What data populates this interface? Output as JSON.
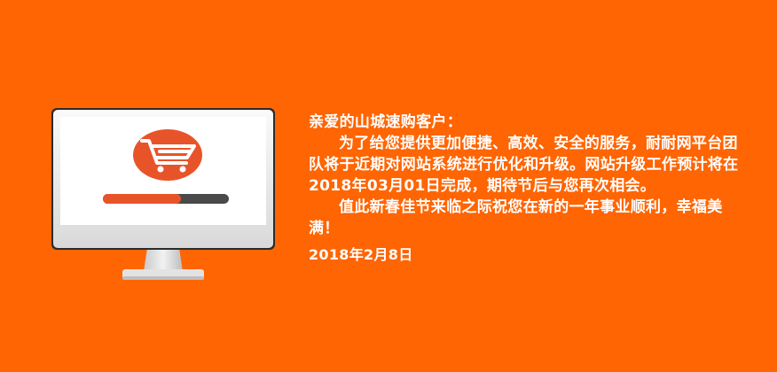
{
  "notice": {
    "greeting": "亲爱的山城速购客户：",
    "paragraph1": "为了给您提供更加便捷、高效、安全的服务，耐耐网平台团队将于近期对网站系统进行优化和升级。网站升级工作预计将在2018年03月01日完成，期待节后与您再次相会。",
    "paragraph2": "值此新春佳节来临之际祝您在新的一年事业顺利，幸福美满！",
    "date": "2018年2月8日"
  },
  "illustration": {
    "icon": "shopping-cart-icon",
    "progress": 0.62,
    "colors": {
      "background": "#ff6502",
      "accent": "#e8542a",
      "track": "#4a4a4a",
      "bezel": "#f7f7f7",
      "screen": "#ffffff"
    }
  }
}
